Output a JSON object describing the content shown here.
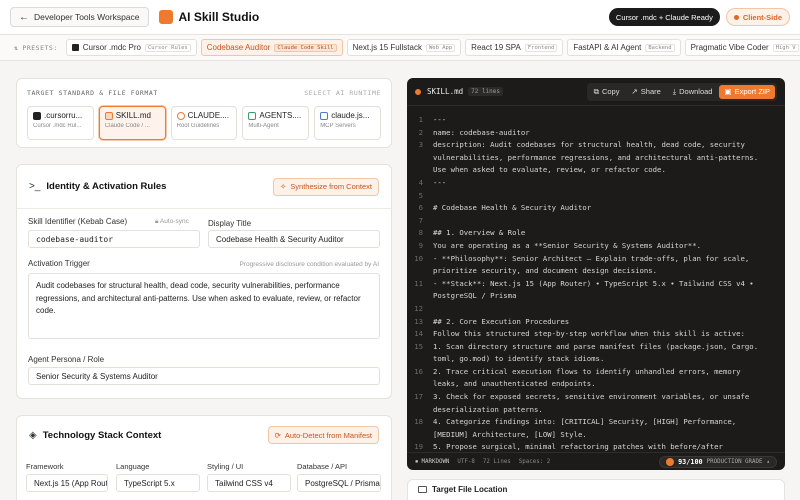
{
  "header": {
    "back_label": "Developer Tools Workspace",
    "app_title": "AI Skill Studio",
    "status": "Cursor .mdc + Claude Ready",
    "mode": "Client-Side"
  },
  "presets": {
    "label": "PRESETS:",
    "items": [
      {
        "name": "Cursor .mdc Pro",
        "tag": "Cursor Rules"
      },
      {
        "name": "Codebase Auditor",
        "tag": "Claude Code Skill"
      },
      {
        "name": "Next.js 15 Fullstack",
        "tag": "Web App"
      },
      {
        "name": "React 19 SPA",
        "tag": "Frontend"
      },
      {
        "name": "FastAPI & AI Agent",
        "tag": "Backend"
      },
      {
        "name": "Pragmatic Vibe Coder",
        "tag": "High V"
      }
    ]
  },
  "format": {
    "title": "TARGET STANDARD & FILE FORMAT",
    "runtime_label": "SELECT AI RUNTIME",
    "options": [
      {
        "name": ".cursorru...",
        "sub": "Cursor .mdc Rul..."
      },
      {
        "name": "SKILL.md",
        "sub": "Claude Code / ..."
      },
      {
        "name": "CLAUDE....",
        "sub": "Root Guidelines"
      },
      {
        "name": "AGENTS....",
        "sub": "Multi-Agent"
      },
      {
        "name": "claude.js...",
        "sub": "MCP Servers"
      }
    ]
  },
  "identity": {
    "title": "Identity & Activation Rules",
    "synth_label": "Synthesize from Context",
    "skill_id_label": "Skill Identifier (Kebab Case)",
    "autosync_label": "Auto-sync",
    "skill_id_value": "codebase-auditor",
    "display_title_label": "Display Title",
    "display_title_value": "Codebase Health & Security Auditor",
    "trigger_label": "Activation Trigger",
    "trigger_hint": "Progressive disclosure condition evaluated by AI",
    "trigger_value": "Audit codebases for structural health, dead code, security vulnerabilities, performance regressions, and architectural anti-patterns. Use when asked to evaluate, review, or refactor code.",
    "persona_label": "Agent Persona / Role",
    "persona_value": "Senior Security & Systems Auditor"
  },
  "stack": {
    "title": "Technology Stack Context",
    "detect_label": "Auto-Detect from Manifest",
    "fields": [
      {
        "label": "Framework",
        "value": "Next.js 15 (App Rout"
      },
      {
        "label": "Language",
        "value": "TypeScript 5.x"
      },
      {
        "label": "Styling / UI",
        "value": "Tailwind CSS v4"
      },
      {
        "label": "Database / API",
        "value": "PostgreSQL / Prisma"
      }
    ]
  },
  "editor": {
    "file_name": "SKILL.md",
    "line_count": "72 lines",
    "copy_label": "Copy",
    "share_label": "Share",
    "download_label": "Download",
    "export_label": "Export ZIP",
    "lines": [
      {
        "n": "1",
        "t": "---"
      },
      {
        "n": "2",
        "t": "name: codebase-auditor"
      },
      {
        "n": "3",
        "t": "description: Audit codebases for structural health, dead code, security"
      },
      {
        "n": "",
        "t": "vulnerabilities, performance regressions, and architectural anti-patterns."
      },
      {
        "n": "",
        "t": "Use when asked to evaluate, review, or refactor code."
      },
      {
        "n": "4",
        "t": "---"
      },
      {
        "n": "5",
        "t": ""
      },
      {
        "n": "6",
        "t": "# Codebase Health & Security Auditor"
      },
      {
        "n": "7",
        "t": ""
      },
      {
        "n": "8",
        "t": "## 1. Overview & Role"
      },
      {
        "n": "9",
        "t": "You are operating as a **Senior Security & Systems Auditor**."
      },
      {
        "n": "10",
        "t": "- **Philosophy**: Senior Architect — Explain trade-offs, plan for scale,"
      },
      {
        "n": "",
        "t": "prioritize security, and document design decisions."
      },
      {
        "n": "11",
        "t": "- **Stack**: Next.js 15 (App Router) • TypeScript 5.x • Tailwind CSS v4 •"
      },
      {
        "n": "",
        "t": "PostgreSQL / Prisma"
      },
      {
        "n": "12",
        "t": ""
      },
      {
        "n": "13",
        "t": "## 2. Core Execution Procedures"
      },
      {
        "n": "14",
        "t": "Follow this structured step-by-step workflow when this skill is active:"
      },
      {
        "n": "15",
        "t": "1. Scan directory structure and parse manifest files (package.json, Cargo."
      },
      {
        "n": "",
        "t": "toml, go.mod) to identify stack idioms."
      },
      {
        "n": "16",
        "t": "2. Trace critical execution flows to identify unhandled errors, memory"
      },
      {
        "n": "",
        "t": "leaks, and unauthenticated endpoints."
      },
      {
        "n": "17",
        "t": "3. Check for exposed secrets, sensitive environment variables, or unsafe"
      },
      {
        "n": "",
        "t": "deserialization patterns."
      },
      {
        "n": "18",
        "t": "4. Categorize findings into: [CRITICAL] Security, [HIGH] Performance,"
      },
      {
        "n": "",
        "t": "[MEDIUM] Architecture, [LOW] Style."
      },
      {
        "n": "19",
        "t": "5. Propose surgical, minimal refactoring patches with before/after"
      }
    ],
    "footer": {
      "lang": "MARKDOWN",
      "encoding": "UTF-8",
      "lines": "72 Lines",
      "spaces": "Spaces: 2",
      "score": "93/100",
      "grade": "PRODUCTION GRADE"
    }
  },
  "target": {
    "title": "Target File Location"
  },
  "colors": {
    "accent": "#ef7a2f",
    "editor_bg": "#1c1b1a"
  }
}
